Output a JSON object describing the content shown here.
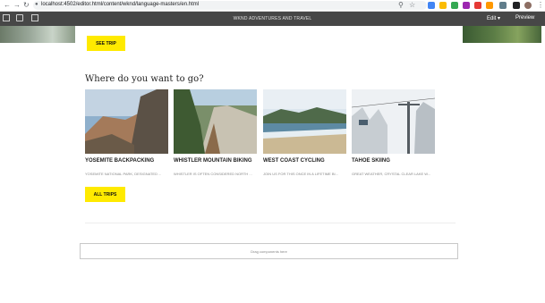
{
  "browser": {
    "url": "localhost:4502/editor.html/content/wknd/language-masters/en.html",
    "back_icon": "arrow-left-icon",
    "forward_icon": "arrow-right-icon",
    "reload_icon": "reload-icon"
  },
  "editor": {
    "title": "WKND ADVENTURES AND TRAVEL",
    "mode": "Edit",
    "preview": "Preview"
  },
  "hero": {
    "button": "SEE TRIP"
  },
  "section": {
    "title": "Where do you want to go?"
  },
  "cards": [
    {
      "title": "YOSEMITE BACKPACKING",
      "desc": "YOSEMITE NATIONAL PARK, DESIGNATED ..."
    },
    {
      "title": "WHISTLER MOUNTAIN BIKING",
      "desc": "WHISTLER IS OFTEN CONSIDERED NORTH ..."
    },
    {
      "title": "WEST COAST CYCLING",
      "desc": "JOIN US FOR THIS ONCE IN A LIFETIME BI..."
    },
    {
      "title": "TAHOE SKIING",
      "desc": "GREAT WEATHER, CRYSTAL CLEAR LAKE W..."
    }
  ],
  "all_trips": "ALL TRIPS",
  "drop_zone": "Drag components here",
  "colors": {
    "accent": "#ffea00",
    "editor_bar": "#474747"
  }
}
